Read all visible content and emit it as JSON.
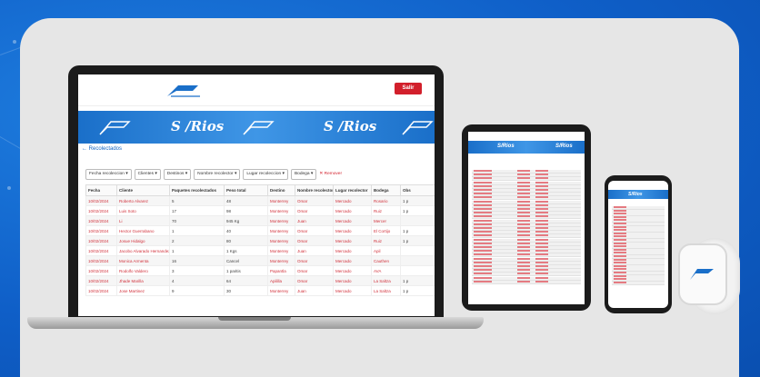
{
  "laptop": {
    "exit_label": "Salir",
    "banner_brand": "S /Rios",
    "breadcrumb": "← Recolectados",
    "filters": [
      "Fecha recoleccion ▾",
      "Clientes ▾",
      "Destinos ▾",
      "Nombre recolector ▾",
      "Lugar recoleccion ▾",
      "Bodega ▾"
    ],
    "clear_filters": "✕ Remover",
    "table": {
      "headers": [
        "Fecha",
        "Cliente",
        "Paquetes recolectados",
        "Peso total",
        "Destino",
        "Nombre recolector",
        "Lugar recolector",
        "Bodega",
        "Obs"
      ],
      "rows": [
        [
          "10/02/2024",
          "Roberto Alvarez",
          "5",
          "48",
          "Monterrey",
          "Omar",
          "Mercado",
          "Rosario",
          "1 p"
        ],
        [
          "10/02/2024",
          "Luis Soto",
          "17",
          "98",
          "Monterrey",
          "Omar",
          "Mercado",
          "Ruiz",
          "1 p"
        ],
        [
          "10/02/2024",
          "Li",
          "70",
          "945 Kg",
          "Monterrey",
          "Juan",
          "Mercado",
          "Mercer",
          ""
        ],
        [
          "10/02/2024",
          "Hector Guerrabano",
          "1",
          "40",
          "Monterrey",
          "Omar",
          "Mercado",
          "El Cortijo",
          "1 p"
        ],
        [
          "10/02/2024",
          "Josue Hidalgo",
          "2",
          "80",
          "Monterrey",
          "Omar",
          "Mercado",
          "Ruiz",
          "1 p"
        ],
        [
          "10/02/2024",
          "Jacobo Alvarado Hernandez",
          "1",
          "1 Kgs",
          "Monterrey",
          "Juan",
          "Mercado",
          "Apil",
          ""
        ],
        [
          "10/02/2024",
          "Monica Armenta",
          "16",
          "Cancel",
          "Monterrey",
          "Omar",
          "Mercado",
          "Cauthen",
          ""
        ],
        [
          "10/02/2024",
          "Rodolfo Valdero",
          "3",
          "1 paritis",
          "Papantla",
          "Omar",
          "Mercado",
          "AVA",
          ""
        ],
        [
          "10/02/2024",
          "Jhade Marilla",
          "4",
          "64",
          "Apililla",
          "Omar",
          "Mercado",
          "La Saltza",
          "1 p"
        ],
        [
          "10/02/2024",
          "Jose Martinez",
          "9",
          "30",
          "Monterrey",
          "Juan",
          "Mercado",
          "La Saltza",
          "1 p"
        ]
      ]
    }
  },
  "tablet": {
    "banner_brand": "S/Rios"
  },
  "phone": {
    "banner_brand": "S/Rios"
  },
  "colors": {
    "background_blue": "#0f5fc8",
    "brand_red": "#d21f2b",
    "banner_blue": "#1a6fc9"
  }
}
